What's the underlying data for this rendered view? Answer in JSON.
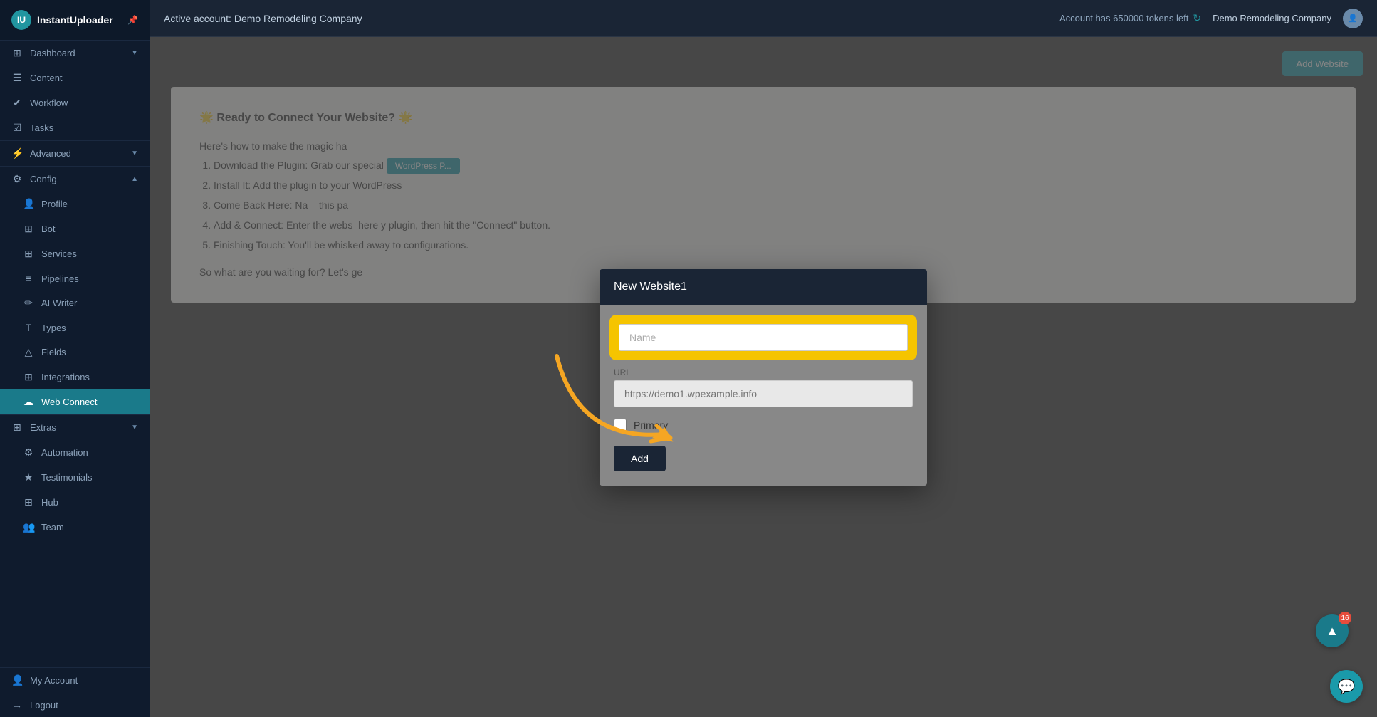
{
  "app": {
    "name": "InstantUploader",
    "logo_letter": "IU"
  },
  "topbar": {
    "active_account": "Active account: Demo Remodeling Company",
    "tokens_text": "Account has 650000 tokens left",
    "account_name": "Demo Remodeling Company"
  },
  "sidebar": {
    "items": [
      {
        "id": "dashboard",
        "label": "Dashboard",
        "icon": "⊞",
        "has_arrow": true
      },
      {
        "id": "content",
        "label": "Content",
        "icon": "☰"
      },
      {
        "id": "workflow",
        "label": "Workflow",
        "icon": "✔"
      },
      {
        "id": "tasks",
        "label": "Tasks",
        "icon": "☑"
      }
    ],
    "config_items": [
      {
        "id": "profile",
        "label": "Profile",
        "icon": "👤",
        "sub": true
      },
      {
        "id": "bot",
        "label": "Bot",
        "icon": "⊞",
        "sub": true
      },
      {
        "id": "services",
        "label": "Services",
        "icon": "⊞",
        "sub": true
      },
      {
        "id": "pipelines",
        "label": "Pipelines",
        "icon": "≡",
        "sub": true
      },
      {
        "id": "ai-writer",
        "label": "AI Writer",
        "icon": "✏",
        "sub": true
      },
      {
        "id": "types",
        "label": "Types",
        "icon": "T",
        "sub": true
      },
      {
        "id": "fields",
        "label": "Fields",
        "icon": "△",
        "sub": true
      },
      {
        "id": "integrations",
        "label": "Integrations",
        "icon": "⊞",
        "sub": true
      },
      {
        "id": "web-connect",
        "label": "Web Connect",
        "icon": "☁",
        "sub": true,
        "active": true
      }
    ],
    "extra_items": [
      {
        "id": "automation",
        "label": "Automation",
        "icon": "⚙"
      },
      {
        "id": "testimonials",
        "label": "Testimonials",
        "icon": "★"
      },
      {
        "id": "hub",
        "label": "Hub",
        "icon": "⊞"
      },
      {
        "id": "team",
        "label": "Team",
        "icon": "👥"
      }
    ],
    "bottom_items": [
      {
        "id": "my-account",
        "label": "My Account",
        "icon": "👤"
      },
      {
        "id": "logout",
        "label": "Logout",
        "icon": "→"
      }
    ],
    "labels": {
      "advanced": "Advanced",
      "config": "Config",
      "extras": "Extras"
    }
  },
  "main": {
    "add_website_btn": "Add Website",
    "ready_section": {
      "title": "🌟 Ready to Connect Your Website? 🌟",
      "intro": "Here's how to make the magic ha",
      "steps": [
        "Download the Plugin: Grab our special",
        "Install It: Add the plugin to your WordPress",
        "Come Back Here: Na  this pa",
        "Add & Connect: Enter the webs  here y",
        "Finishing Touch: You'll be whisked away to",
        "configurations."
      ],
      "outro": "So what are you waiting for? Let's ge"
    }
  },
  "modal": {
    "title": "New Website1",
    "name_label": "Name",
    "name_placeholder": "Name",
    "url_label": "URL",
    "url_placeholder": "https://demo1.wpexample.info",
    "primary_label": "Primary",
    "add_button": "Add"
  },
  "chat": {
    "icon": "💬",
    "badge": "16",
    "scroll_icon": "▲"
  }
}
